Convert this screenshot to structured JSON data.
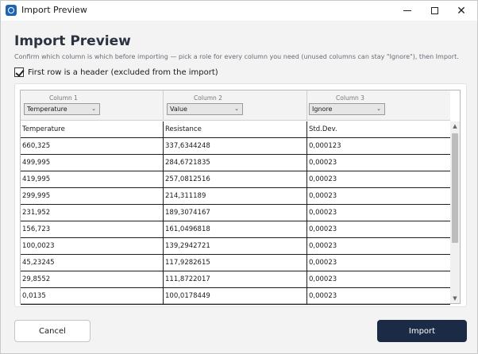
{
  "window": {
    "title": "Import Preview"
  },
  "dialog": {
    "heading": "Import Preview",
    "subtitle": "Confirm which column is which before importing — pick a role for every column you need (unused columns can stay \"Ignore\"), then Import.",
    "header_checkbox": {
      "label": "First row is a header (excluded from the import)",
      "checked": true
    }
  },
  "columns": [
    {
      "label": "Column 1",
      "role": "Temperature"
    },
    {
      "label": "Column 2",
      "role": "Value"
    },
    {
      "label": "Column 3",
      "role": "Ignore"
    }
  ],
  "table": {
    "header": [
      "Temperature",
      "Resistance",
      "Std.Dev."
    ],
    "rows": [
      [
        "660,325",
        "337,6344248",
        "0,000123"
      ],
      [
        "499,995",
        "284,6721835",
        "0,00023"
      ],
      [
        "419,995",
        "257,0812516",
        "0,00023"
      ],
      [
        "299,995",
        "214,311189",
        "0,00023"
      ],
      [
        "231,952",
        "189,3074167",
        "0,00023"
      ],
      [
        "156,723",
        "161,0496818",
        "0,00023"
      ],
      [
        "100,0023",
        "139,2942721",
        "0,00023"
      ],
      [
        "45,23245",
        "117,9282615",
        "0,00023"
      ],
      [
        "29,8552",
        "111,8722017",
        "0,00023"
      ],
      [
        "0,0135",
        "100,0178449",
        "0,00023"
      ]
    ]
  },
  "buttons": {
    "cancel": "Cancel",
    "import": "Import"
  },
  "icons": {
    "app": "app-icon",
    "minimize": "minimize-icon",
    "maximize": "maximize-icon",
    "close": "close-icon",
    "dropdown": "chevron-down-icon",
    "scroll_up": "chevron-up-icon",
    "scroll_down": "chevron-down-icon"
  },
  "colors": {
    "primary_button": "#1c2b45",
    "heading": "#2b3340"
  }
}
